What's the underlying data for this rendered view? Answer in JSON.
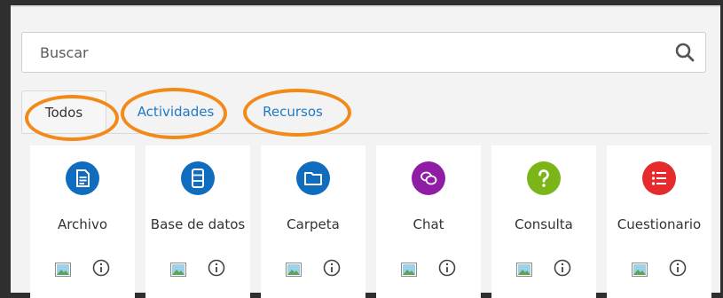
{
  "search": {
    "placeholder": "Buscar"
  },
  "tabs": [
    {
      "label": "Todos",
      "active": true
    },
    {
      "label": "Actividades",
      "active": false
    },
    {
      "label": "Recursos",
      "active": false
    }
  ],
  "items": [
    {
      "label": "Archivo",
      "icon": "file-icon",
      "color": "#0f6cbf"
    },
    {
      "label": "Base de datos",
      "icon": "database-icon",
      "color": "#0f6cbf"
    },
    {
      "label": "Carpeta",
      "icon": "folder-icon",
      "color": "#0f6cbf"
    },
    {
      "label": "Chat",
      "icon": "chat-icon",
      "color": "#8f1ea5"
    },
    {
      "label": "Consulta",
      "icon": "question-icon",
      "color": "#7cb518"
    },
    {
      "label": "Cuestionario",
      "icon": "list-icon",
      "color": "#e52b2b"
    }
  ],
  "colors": {
    "highlight": "#f28a1a",
    "link": "#1f79c6"
  }
}
